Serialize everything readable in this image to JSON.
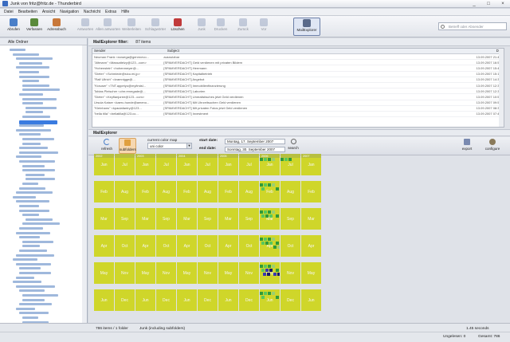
{
  "window": {
    "title": "Junk von fritz@fritz.de - Thunderbird",
    "controls": [
      "_",
      "□",
      "×"
    ]
  },
  "menu": [
    "Datei",
    "Bearbeiten",
    "Ansicht",
    "Navigation",
    "Nachricht",
    "Extras",
    "Hilfe"
  ],
  "toolbar": {
    "buttons": [
      {
        "label": "Abrufen",
        "icon": "get-mail-icon",
        "color": "#4a7fc8",
        "enabled": true
      },
      {
        "label": "Verfassen",
        "icon": "compose-icon",
        "color": "#5a8a3a",
        "enabled": true
      },
      {
        "label": "Adressbuch",
        "icon": "addressbook-icon",
        "color": "#c8783a",
        "enabled": true
      },
      {
        "label": "Antworten",
        "icon": "reply-icon",
        "color": "#8a9ab8",
        "enabled": false
      },
      {
        "label": "Allen antworten",
        "icon": "reply-all-icon",
        "color": "#8a9ab8",
        "enabled": false
      },
      {
        "label": "Weiterleiten",
        "icon": "forward-icon",
        "color": "#8a9ab8",
        "enabled": false
      },
      {
        "label": "Schlagwörter",
        "icon": "tag-icon",
        "color": "#8a9ab8",
        "enabled": false
      },
      {
        "label": "Löschen",
        "icon": "delete-icon",
        "color": "#c03a3a",
        "enabled": true
      },
      {
        "label": "Junk",
        "icon": "junk-icon",
        "color": "#8a9ab8",
        "enabled": false
      },
      {
        "label": "Drucken",
        "icon": "print-icon",
        "color": "#8a9ab8",
        "enabled": false
      },
      {
        "label": "Zurück",
        "icon": "back-icon",
        "color": "#8a9ab8",
        "enabled": false
      },
      {
        "label": "Vor",
        "icon": "forward-nav-icon",
        "color": "#8a9ab8",
        "enabled": false
      },
      {
        "label": "MailExplorer",
        "icon": "mailexplorer-icon",
        "color": "#5a6a8a",
        "enabled": true
      }
    ],
    "search_placeholder": "Betreff oder Absender"
  },
  "folders": {
    "header": "Alle Ordner"
  },
  "mailexplorer": {
    "filter_label": "MailExplorer filter:",
    "filter_count": "87 items",
    "columns": [
      "Sender",
      "Subject",
      "Date"
    ],
    "rows": [
      {
        "sender": "Neuman Frank <nowega@genmxrvo...",
        "subject": "ausnutzbar",
        "date": "13.09.2007 21:47:36"
      },
      {
        "sender": "\"Altmann\" <Massaitelzy@123...com>",
        "subject": "[SPAMVERDACHT] Geld verdienen mit privaten Bildern",
        "date": "13.09.2007 16:52:38"
      },
      {
        "sender": "\"Hohenstein\" <hohenmeyer@...",
        "subject": "[SPAMVERDACHT] Herrmann",
        "date": "13.09.2007 15:49:04"
      },
      {
        "sender": "\"Dieter\" <Schmiede@sicu.mi.jp>",
        "subject": "[SPAMVERDACHT] Kapitalbetrieb",
        "date": "13.09.2007 15:15:58"
      },
      {
        "sender": "\"Ralf Ullrich\" <kramnigge@...",
        "subject": "[SPAMVERDACHT] Angebot",
        "date": "13.09.2007 14:36:36"
      },
      {
        "sender": "\"Krauser\" <TNT.appetyo@myfirstsl...",
        "subject": "[SPAMVERDACHT] Immobilienfinanzierung",
        "date": "13.09.2007 12:39:31"
      },
      {
        "sender": "Tobias Pleischer <chrr.renegade@...",
        "subject": "[SPAMVERDACHT] Laborien",
        "date": "13.09.2007 12:38:47"
      },
      {
        "sender": "\"Dieter\" <Keyflanjoree@123...com>",
        "subject": "[SPAMVERDACHT] Unrealistisches jetzt Geld verdienen",
        "date": "13.09.2007 10:59:08"
      },
      {
        "sender": "Ursula Kaiser <kaeru.hunde@ameno...",
        "subject": "[SPAMVERDACHT] Mit Uhrzeitsuchen Geld verdienen",
        "date": "13.09.2007 09:51:55"
      },
      {
        "sender": "\"Kleinhans\" <kpaulafantry@123...",
        "subject": "[SPAMVERDACHT] Mit privaten Fotos jetzt Geld verdienen",
        "date": "13.09.2007 08:33:28"
      },
      {
        "sender": "\"bella tilla\" <bellatilla@123.co...",
        "subject": "[SPAMVERDACHT] Investment",
        "date": "13.09.2007 07:47:51"
      }
    ],
    "section_label": "MailExplorer",
    "panel": {
      "refresh_label": "refresh",
      "subfolders_label": "subfolders",
      "colormap_label": "current color map",
      "colormap_value": "uni color",
      "start_label": "start date:",
      "start_value": "Montag, 17. September 2007",
      "end_label": "end date:",
      "end_value": "Sonntag, 30. September 2007",
      "search_label": "search",
      "export_label": "export",
      "configure_label": "configure"
    }
  },
  "calendar": {
    "row_labels": [
      [
        "Jan",
        "Jul",
        "Jan",
        "Jul",
        "Jan",
        "Jul",
        "Jan",
        "Jul",
        "Jan",
        "Jul",
        "Jan"
      ],
      [
        "Feb",
        "Aug",
        "Feb",
        "Aug",
        "Feb",
        "Aug",
        "Feb",
        "Aug",
        "Feb",
        "Aug",
        "Feb"
      ],
      [
        "Mar",
        "Sep",
        "Mar",
        "Sep",
        "Mar",
        "Sep",
        "Mar",
        "Sep",
        "Mar",
        "Sep",
        "Mar"
      ],
      [
        "Apr",
        "Oct",
        "Apr",
        "Oct",
        "Apr",
        "Oct",
        "Apr",
        "Oct",
        "Apr",
        "Oct",
        "Apr"
      ],
      [
        "May",
        "Nov",
        "May",
        "Nov",
        "May",
        "Nov",
        "May",
        "Nov",
        "May",
        "Nov",
        "May"
      ],
      [
        "Jun",
        "Dec",
        "Jun",
        "Dec",
        "Jun",
        "Dec",
        "Jun",
        "Dec",
        "Jun",
        "Dec",
        "Jun"
      ]
    ],
    "year_labels": [
      "2002",
      "",
      "2003",
      "",
      "2004",
      "",
      "2005",
      "",
      "2006",
      "",
      "2007"
    ],
    "cell_color": "#cfd62a",
    "activity_colors": [
      "#2f9a3a",
      "#5ac85a",
      "#3a3ab0",
      "#1a1a6a",
      "#9ad070"
    ]
  },
  "status": {
    "items": "786 items / 1 folder",
    "folder": "Junk (including subfolders)",
    "time": "1.45 seconds",
    "unread": "Ungelesen: 0",
    "total": "Gesamt: 786"
  }
}
